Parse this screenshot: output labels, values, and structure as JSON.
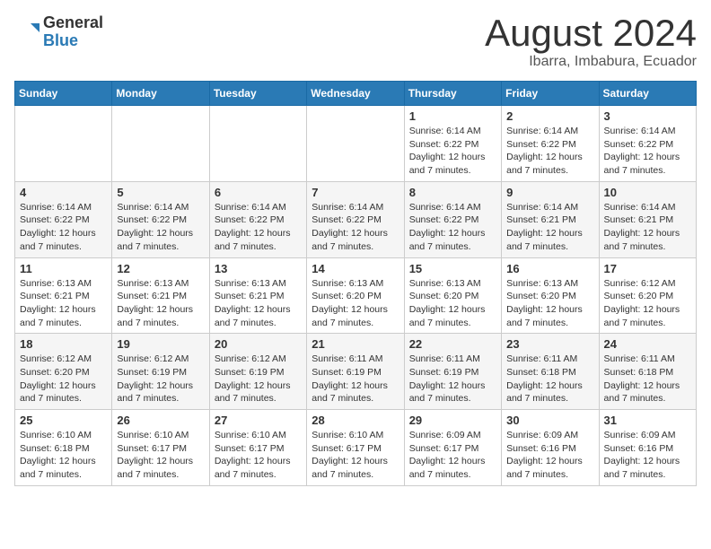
{
  "logo": {
    "general": "General",
    "blue": "Blue"
  },
  "header": {
    "month": "August 2024",
    "location": "Ibarra, Imbabura, Ecuador"
  },
  "weekdays": [
    "Sunday",
    "Monday",
    "Tuesday",
    "Wednesday",
    "Thursday",
    "Friday",
    "Saturday"
  ],
  "weeks": [
    [
      {
        "day": "",
        "info": ""
      },
      {
        "day": "",
        "info": ""
      },
      {
        "day": "",
        "info": ""
      },
      {
        "day": "",
        "info": ""
      },
      {
        "day": "1",
        "info": "Sunrise: 6:14 AM\nSunset: 6:22 PM\nDaylight: 12 hours and 7 minutes."
      },
      {
        "day": "2",
        "info": "Sunrise: 6:14 AM\nSunset: 6:22 PM\nDaylight: 12 hours and 7 minutes."
      },
      {
        "day": "3",
        "info": "Sunrise: 6:14 AM\nSunset: 6:22 PM\nDaylight: 12 hours and 7 minutes."
      }
    ],
    [
      {
        "day": "4",
        "info": "Sunrise: 6:14 AM\nSunset: 6:22 PM\nDaylight: 12 hours and 7 minutes."
      },
      {
        "day": "5",
        "info": "Sunrise: 6:14 AM\nSunset: 6:22 PM\nDaylight: 12 hours and 7 minutes."
      },
      {
        "day": "6",
        "info": "Sunrise: 6:14 AM\nSunset: 6:22 PM\nDaylight: 12 hours and 7 minutes."
      },
      {
        "day": "7",
        "info": "Sunrise: 6:14 AM\nSunset: 6:22 PM\nDaylight: 12 hours and 7 minutes."
      },
      {
        "day": "8",
        "info": "Sunrise: 6:14 AM\nSunset: 6:22 PM\nDaylight: 12 hours and 7 minutes."
      },
      {
        "day": "9",
        "info": "Sunrise: 6:14 AM\nSunset: 6:21 PM\nDaylight: 12 hours and 7 minutes."
      },
      {
        "day": "10",
        "info": "Sunrise: 6:14 AM\nSunset: 6:21 PM\nDaylight: 12 hours and 7 minutes."
      }
    ],
    [
      {
        "day": "11",
        "info": "Sunrise: 6:13 AM\nSunset: 6:21 PM\nDaylight: 12 hours and 7 minutes."
      },
      {
        "day": "12",
        "info": "Sunrise: 6:13 AM\nSunset: 6:21 PM\nDaylight: 12 hours and 7 minutes."
      },
      {
        "day": "13",
        "info": "Sunrise: 6:13 AM\nSunset: 6:21 PM\nDaylight: 12 hours and 7 minutes."
      },
      {
        "day": "14",
        "info": "Sunrise: 6:13 AM\nSunset: 6:20 PM\nDaylight: 12 hours and 7 minutes."
      },
      {
        "day": "15",
        "info": "Sunrise: 6:13 AM\nSunset: 6:20 PM\nDaylight: 12 hours and 7 minutes."
      },
      {
        "day": "16",
        "info": "Sunrise: 6:13 AM\nSunset: 6:20 PM\nDaylight: 12 hours and 7 minutes."
      },
      {
        "day": "17",
        "info": "Sunrise: 6:12 AM\nSunset: 6:20 PM\nDaylight: 12 hours and 7 minutes."
      }
    ],
    [
      {
        "day": "18",
        "info": "Sunrise: 6:12 AM\nSunset: 6:20 PM\nDaylight: 12 hours and 7 minutes."
      },
      {
        "day": "19",
        "info": "Sunrise: 6:12 AM\nSunset: 6:19 PM\nDaylight: 12 hours and 7 minutes."
      },
      {
        "day": "20",
        "info": "Sunrise: 6:12 AM\nSunset: 6:19 PM\nDaylight: 12 hours and 7 minutes."
      },
      {
        "day": "21",
        "info": "Sunrise: 6:11 AM\nSunset: 6:19 PM\nDaylight: 12 hours and 7 minutes."
      },
      {
        "day": "22",
        "info": "Sunrise: 6:11 AM\nSunset: 6:19 PM\nDaylight: 12 hours and 7 minutes."
      },
      {
        "day": "23",
        "info": "Sunrise: 6:11 AM\nSunset: 6:18 PM\nDaylight: 12 hours and 7 minutes."
      },
      {
        "day": "24",
        "info": "Sunrise: 6:11 AM\nSunset: 6:18 PM\nDaylight: 12 hours and 7 minutes."
      }
    ],
    [
      {
        "day": "25",
        "info": "Sunrise: 6:10 AM\nSunset: 6:18 PM\nDaylight: 12 hours and 7 minutes."
      },
      {
        "day": "26",
        "info": "Sunrise: 6:10 AM\nSunset: 6:17 PM\nDaylight: 12 hours and 7 minutes."
      },
      {
        "day": "27",
        "info": "Sunrise: 6:10 AM\nSunset: 6:17 PM\nDaylight: 12 hours and 7 minutes."
      },
      {
        "day": "28",
        "info": "Sunrise: 6:10 AM\nSunset: 6:17 PM\nDaylight: 12 hours and 7 minutes."
      },
      {
        "day": "29",
        "info": "Sunrise: 6:09 AM\nSunset: 6:17 PM\nDaylight: 12 hours and 7 minutes."
      },
      {
        "day": "30",
        "info": "Sunrise: 6:09 AM\nSunset: 6:16 PM\nDaylight: 12 hours and 7 minutes."
      },
      {
        "day": "31",
        "info": "Sunrise: 6:09 AM\nSunset: 6:16 PM\nDaylight: 12 hours and 7 minutes."
      }
    ]
  ]
}
